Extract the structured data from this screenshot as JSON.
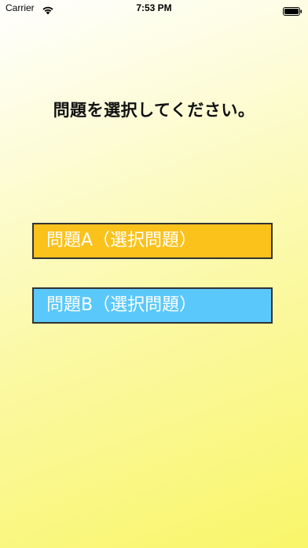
{
  "status_bar": {
    "carrier": "Carrier",
    "time": "7:53 PM",
    "wifi_icon": "wifi-icon",
    "battery_icon": "battery-icon"
  },
  "main": {
    "prompt": "問題を選択してください。",
    "buttons": [
      {
        "label": "問題A（選択問題）",
        "color": "#fbc21c"
      },
      {
        "label": "問題B（選択問題）",
        "color": "#5ac8fa"
      }
    ]
  },
  "colors": {
    "background_start": "#ffffff",
    "background_end": "#f9f66a",
    "button_text": "#ffffff",
    "button_border": "#333333"
  }
}
